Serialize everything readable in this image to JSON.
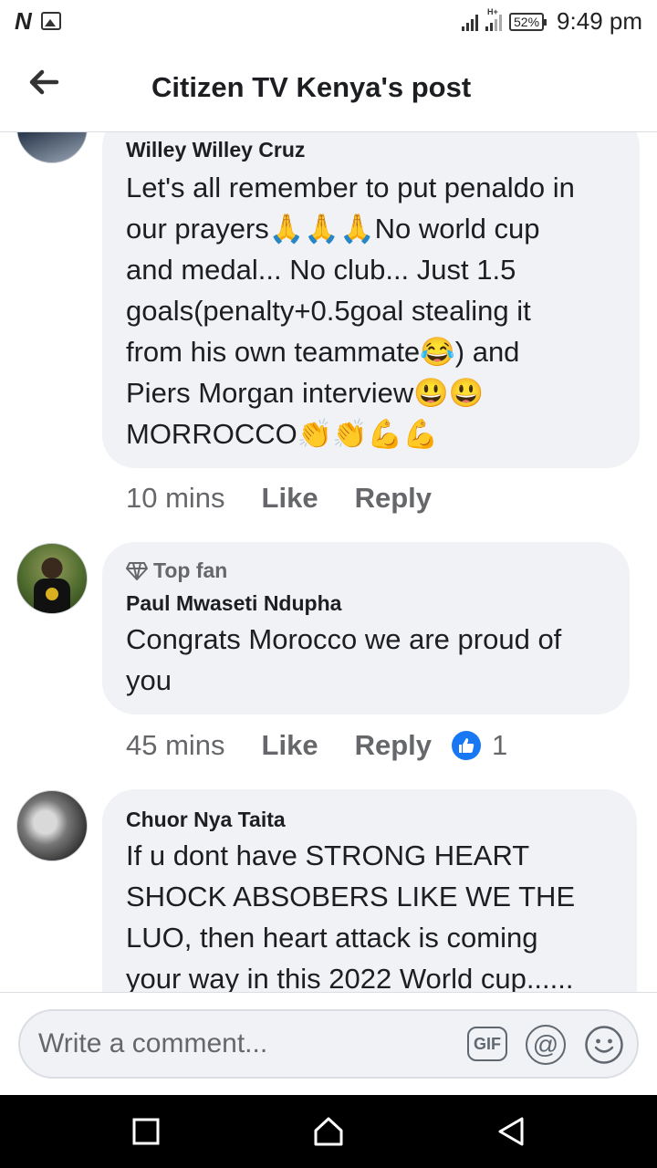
{
  "status_bar": {
    "left_icons": [
      "netflix-n-icon",
      "gallery-icon"
    ],
    "network_label": "H+",
    "battery": "52%",
    "time": "9:49 pm"
  },
  "header": {
    "title": "Citizen TV Kenya's post",
    "back_icon": "arrow-left-icon"
  },
  "comments": [
    {
      "author": "Willey Willey Cruz",
      "lines": [
        "Let's all remember to put penaldo in",
        "our prayers🙏🙏🙏No world cup",
        "and medal... No club... Just 1.5",
        "goals(penalty+0.5goal stealing it",
        "from his own teammate😂)  and",
        "Piers Morgan interview😃😃",
        "MORROCCO👏👏💪💪"
      ],
      "time": "10 mins",
      "like_label": "Like",
      "reply_label": "Reply"
    },
    {
      "badge": "Top fan",
      "author": "Paul Mwaseti Ndupha",
      "lines": [
        "Congrats Morocco we are proud of",
        "you"
      ],
      "time": "45 mins",
      "like_label": "Like",
      "reply_label": "Reply",
      "reaction_count": "1"
    },
    {
      "author": "Chuor Nya Taita",
      "lines": [
        "If u dont have STRONG HEART",
        "SHOCK ABSOBERS LIKE WE THE",
        "LUO, then heart attack is coming",
        "your way in this 2022 World cup......"
      ]
    }
  ],
  "composer": {
    "placeholder": "Write a comment...",
    "gif_label": "GIF",
    "at_label": "@"
  },
  "colors": {
    "bubble": "#f0f2f5",
    "muted_text": "#65676b",
    "like_blue": "#1877f2"
  }
}
